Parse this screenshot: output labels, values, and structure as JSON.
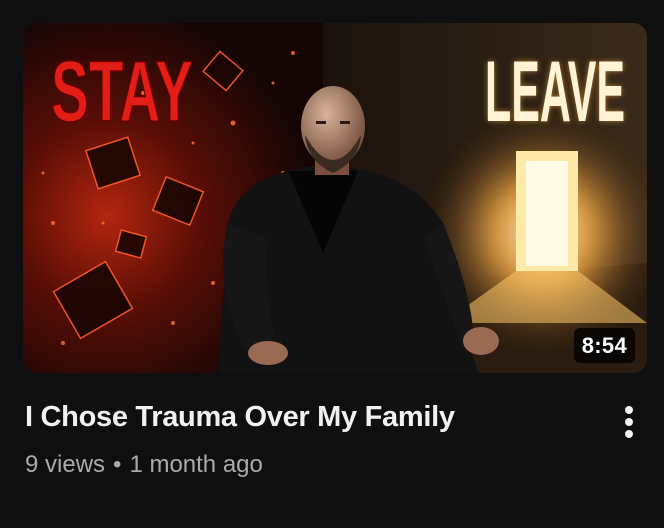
{
  "video": {
    "thumbnail_left_text": "STAY",
    "thumbnail_right_text": "LEAVE",
    "duration": "8:54",
    "title": "I Chose Trauma Over My Family",
    "views": "9 views",
    "separator": "•",
    "age": "1 month ago"
  },
  "colors": {
    "background": "#0f0f0f",
    "title": "#f1f1f1",
    "meta": "#aaaaaa",
    "stay_red": "#e21e16",
    "leave_glow": "#ffd58a"
  },
  "icons": {
    "more": "vertical-ellipsis-icon"
  }
}
